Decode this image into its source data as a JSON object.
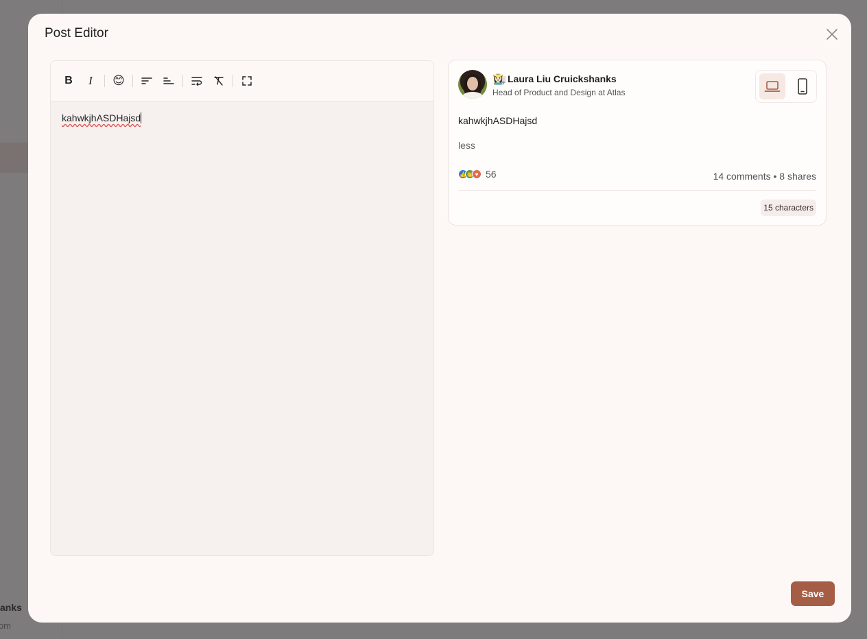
{
  "modal": {
    "title": "Post Editor",
    "save_label": "Save"
  },
  "editor": {
    "toolbar": {
      "bold_label": "B",
      "italic_label": "I",
      "emoji": "😊"
    },
    "content": "kahwkjhASDHajsd"
  },
  "preview": {
    "author": {
      "emoji": "👩🏻‍🌾",
      "name": "Laura Liu Cruickshanks",
      "title": "Head of Product and Design at Atlas"
    },
    "post_text": "kahwkjhASDHajsd",
    "less_label": "less",
    "reaction_count": "56",
    "engagement": "14 comments • 8 shares",
    "char_count": "15 characters",
    "device_mode": "desktop"
  },
  "background": {
    "user_name_fragment": "anks",
    "user_sub_fragment": "om"
  },
  "colors": {
    "accent": "#a55e45",
    "modal_bg": "#fdf8f6",
    "overlay": "#7b7979"
  }
}
